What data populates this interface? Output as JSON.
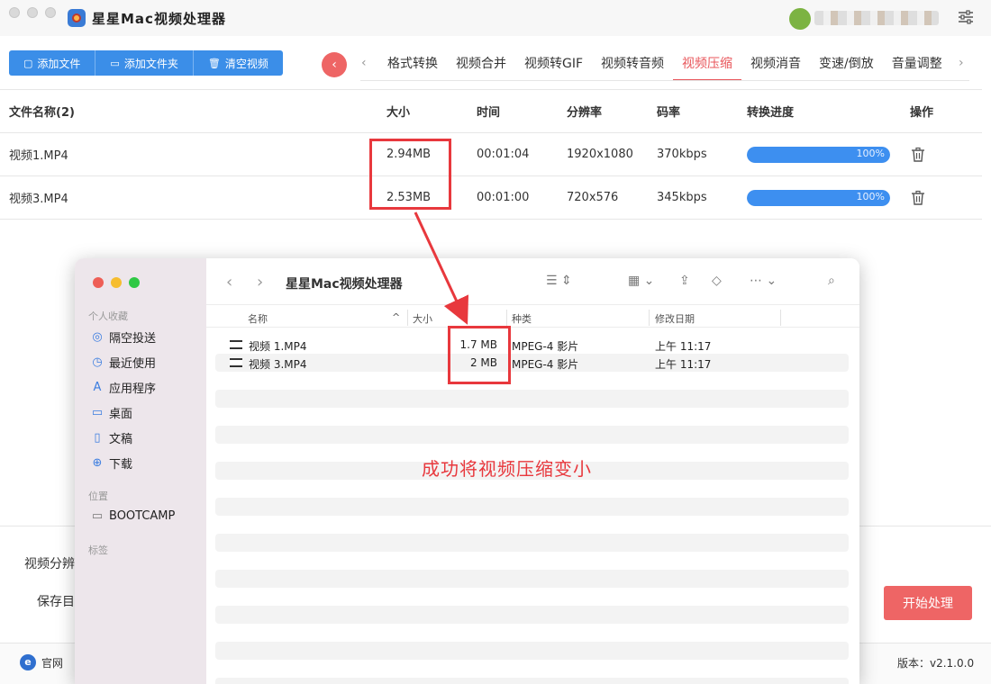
{
  "app": {
    "title": "星星Mac视频处理器"
  },
  "toolbar": {
    "add_file": "添加文件",
    "add_folder": "添加文件夹",
    "clear": "清空视频"
  },
  "tabs": [
    {
      "label": "格式转换",
      "active": false
    },
    {
      "label": "视频合并",
      "active": false
    },
    {
      "label": "视频转GIF",
      "active": false
    },
    {
      "label": "视频转音频",
      "active": false
    },
    {
      "label": "视频压缩",
      "active": true
    },
    {
      "label": "视频消音",
      "active": false
    },
    {
      "label": "变速/倒放",
      "active": false
    },
    {
      "label": "音量调整",
      "active": false
    }
  ],
  "table": {
    "headers": {
      "name": "文件名称(2)",
      "size": "大小",
      "time": "时间",
      "resolution": "分辨率",
      "bitrate": "码率",
      "progress": "转换进度",
      "actions": "操作"
    },
    "rows": [
      {
        "name": "视频1.MP4",
        "size": "2.94MB",
        "time": "00:01:04",
        "resolution": "1920x1080",
        "bitrate": "370kbps",
        "progress": 1.0,
        "progress_label": "100%"
      },
      {
        "name": "视频3.MP4",
        "size": "2.53MB",
        "time": "00:01:00",
        "resolution": "720x576",
        "bitrate": "345kbps",
        "progress": 1.0,
        "progress_label": "100%"
      }
    ]
  },
  "bottom": {
    "resolution_label": "视频分辨",
    "save_label": "保存目",
    "start_button": "开始处理"
  },
  "footer": {
    "site_link": "官网",
    "version": "版本：v2.1.0.0"
  },
  "finder": {
    "title": "星星Mac视频处理器",
    "sidebar": {
      "favorites_title": "个人收藏",
      "favorites": [
        {
          "label": "隔空投送",
          "icon": "airdrop-icon"
        },
        {
          "label": "最近使用",
          "icon": "clock-icon"
        },
        {
          "label": "应用程序",
          "icon": "applications-icon"
        },
        {
          "label": "桌面",
          "icon": "desktop-icon"
        },
        {
          "label": "文稿",
          "icon": "document-icon"
        },
        {
          "label": "下载",
          "icon": "download-icon"
        }
      ],
      "locations_title": "位置",
      "locations": [
        {
          "label": "BOOTCAMP",
          "icon": "disk-icon"
        }
      ],
      "tags_title": "标签"
    },
    "columns": {
      "name": "名称",
      "size": "大小",
      "kind": "种类",
      "date": "修改日期"
    },
    "files": [
      {
        "name": "视频 1.MP4",
        "size": "1.7 MB",
        "kind": "MPEG-4 影片",
        "date": "上午 11:17"
      },
      {
        "name": "视频 3.MP4",
        "size": "2 MB",
        "kind": "MPEG-4 影片",
        "date": "上午 11:17"
      }
    ]
  },
  "annotation": {
    "text": "成功将视频压缩变小",
    "color": "#e8383d"
  }
}
